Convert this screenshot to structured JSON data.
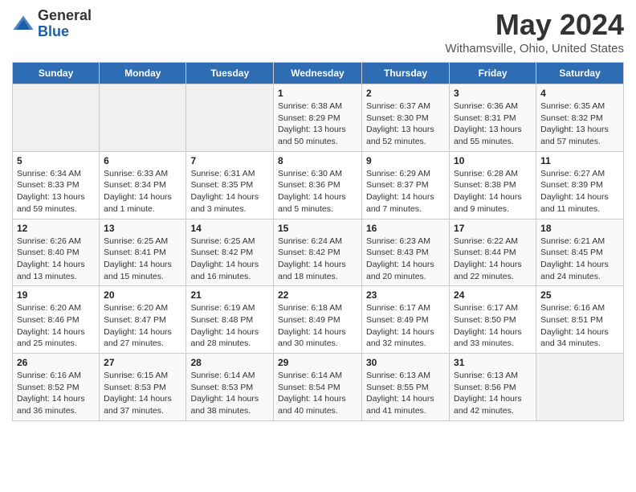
{
  "logo": {
    "general": "General",
    "blue": "Blue"
  },
  "header": {
    "title": "May 2024",
    "subtitle": "Withamsville, Ohio, United States"
  },
  "days_of_week": [
    "Sunday",
    "Monday",
    "Tuesday",
    "Wednesday",
    "Thursday",
    "Friday",
    "Saturday"
  ],
  "weeks": [
    [
      {
        "day": "",
        "sunrise": "",
        "sunset": "",
        "daylight": ""
      },
      {
        "day": "",
        "sunrise": "",
        "sunset": "",
        "daylight": ""
      },
      {
        "day": "",
        "sunrise": "",
        "sunset": "",
        "daylight": ""
      },
      {
        "day": "1",
        "sunrise": "Sunrise: 6:38 AM",
        "sunset": "Sunset: 8:29 PM",
        "daylight": "Daylight: 13 hours and 50 minutes."
      },
      {
        "day": "2",
        "sunrise": "Sunrise: 6:37 AM",
        "sunset": "Sunset: 8:30 PM",
        "daylight": "Daylight: 13 hours and 52 minutes."
      },
      {
        "day": "3",
        "sunrise": "Sunrise: 6:36 AM",
        "sunset": "Sunset: 8:31 PM",
        "daylight": "Daylight: 13 hours and 55 minutes."
      },
      {
        "day": "4",
        "sunrise": "Sunrise: 6:35 AM",
        "sunset": "Sunset: 8:32 PM",
        "daylight": "Daylight: 13 hours and 57 minutes."
      }
    ],
    [
      {
        "day": "5",
        "sunrise": "Sunrise: 6:34 AM",
        "sunset": "Sunset: 8:33 PM",
        "daylight": "Daylight: 13 hours and 59 minutes."
      },
      {
        "day": "6",
        "sunrise": "Sunrise: 6:33 AM",
        "sunset": "Sunset: 8:34 PM",
        "daylight": "Daylight: 14 hours and 1 minute."
      },
      {
        "day": "7",
        "sunrise": "Sunrise: 6:31 AM",
        "sunset": "Sunset: 8:35 PM",
        "daylight": "Daylight: 14 hours and 3 minutes."
      },
      {
        "day": "8",
        "sunrise": "Sunrise: 6:30 AM",
        "sunset": "Sunset: 8:36 PM",
        "daylight": "Daylight: 14 hours and 5 minutes."
      },
      {
        "day": "9",
        "sunrise": "Sunrise: 6:29 AM",
        "sunset": "Sunset: 8:37 PM",
        "daylight": "Daylight: 14 hours and 7 minutes."
      },
      {
        "day": "10",
        "sunrise": "Sunrise: 6:28 AM",
        "sunset": "Sunset: 8:38 PM",
        "daylight": "Daylight: 14 hours and 9 minutes."
      },
      {
        "day": "11",
        "sunrise": "Sunrise: 6:27 AM",
        "sunset": "Sunset: 8:39 PM",
        "daylight": "Daylight: 14 hours and 11 minutes."
      }
    ],
    [
      {
        "day": "12",
        "sunrise": "Sunrise: 6:26 AM",
        "sunset": "Sunset: 8:40 PM",
        "daylight": "Daylight: 14 hours and 13 minutes."
      },
      {
        "day": "13",
        "sunrise": "Sunrise: 6:25 AM",
        "sunset": "Sunset: 8:41 PM",
        "daylight": "Daylight: 14 hours and 15 minutes."
      },
      {
        "day": "14",
        "sunrise": "Sunrise: 6:25 AM",
        "sunset": "Sunset: 8:42 PM",
        "daylight": "Daylight: 14 hours and 16 minutes."
      },
      {
        "day": "15",
        "sunrise": "Sunrise: 6:24 AM",
        "sunset": "Sunset: 8:42 PM",
        "daylight": "Daylight: 14 hours and 18 minutes."
      },
      {
        "day": "16",
        "sunrise": "Sunrise: 6:23 AM",
        "sunset": "Sunset: 8:43 PM",
        "daylight": "Daylight: 14 hours and 20 minutes."
      },
      {
        "day": "17",
        "sunrise": "Sunrise: 6:22 AM",
        "sunset": "Sunset: 8:44 PM",
        "daylight": "Daylight: 14 hours and 22 minutes."
      },
      {
        "day": "18",
        "sunrise": "Sunrise: 6:21 AM",
        "sunset": "Sunset: 8:45 PM",
        "daylight": "Daylight: 14 hours and 24 minutes."
      }
    ],
    [
      {
        "day": "19",
        "sunrise": "Sunrise: 6:20 AM",
        "sunset": "Sunset: 8:46 PM",
        "daylight": "Daylight: 14 hours and 25 minutes."
      },
      {
        "day": "20",
        "sunrise": "Sunrise: 6:20 AM",
        "sunset": "Sunset: 8:47 PM",
        "daylight": "Daylight: 14 hours and 27 minutes."
      },
      {
        "day": "21",
        "sunrise": "Sunrise: 6:19 AM",
        "sunset": "Sunset: 8:48 PM",
        "daylight": "Daylight: 14 hours and 28 minutes."
      },
      {
        "day": "22",
        "sunrise": "Sunrise: 6:18 AM",
        "sunset": "Sunset: 8:49 PM",
        "daylight": "Daylight: 14 hours and 30 minutes."
      },
      {
        "day": "23",
        "sunrise": "Sunrise: 6:17 AM",
        "sunset": "Sunset: 8:49 PM",
        "daylight": "Daylight: 14 hours and 32 minutes."
      },
      {
        "day": "24",
        "sunrise": "Sunrise: 6:17 AM",
        "sunset": "Sunset: 8:50 PM",
        "daylight": "Daylight: 14 hours and 33 minutes."
      },
      {
        "day": "25",
        "sunrise": "Sunrise: 6:16 AM",
        "sunset": "Sunset: 8:51 PM",
        "daylight": "Daylight: 14 hours and 34 minutes."
      }
    ],
    [
      {
        "day": "26",
        "sunrise": "Sunrise: 6:16 AM",
        "sunset": "Sunset: 8:52 PM",
        "daylight": "Daylight: 14 hours and 36 minutes."
      },
      {
        "day": "27",
        "sunrise": "Sunrise: 6:15 AM",
        "sunset": "Sunset: 8:53 PM",
        "daylight": "Daylight: 14 hours and 37 minutes."
      },
      {
        "day": "28",
        "sunrise": "Sunrise: 6:14 AM",
        "sunset": "Sunset: 8:53 PM",
        "daylight": "Daylight: 14 hours and 38 minutes."
      },
      {
        "day": "29",
        "sunrise": "Sunrise: 6:14 AM",
        "sunset": "Sunset: 8:54 PM",
        "daylight": "Daylight: 14 hours and 40 minutes."
      },
      {
        "day": "30",
        "sunrise": "Sunrise: 6:13 AM",
        "sunset": "Sunset: 8:55 PM",
        "daylight": "Daylight: 14 hours and 41 minutes."
      },
      {
        "day": "31",
        "sunrise": "Sunrise: 6:13 AM",
        "sunset": "Sunset: 8:56 PM",
        "daylight": "Daylight: 14 hours and 42 minutes."
      },
      {
        "day": "",
        "sunrise": "",
        "sunset": "",
        "daylight": ""
      }
    ]
  ]
}
